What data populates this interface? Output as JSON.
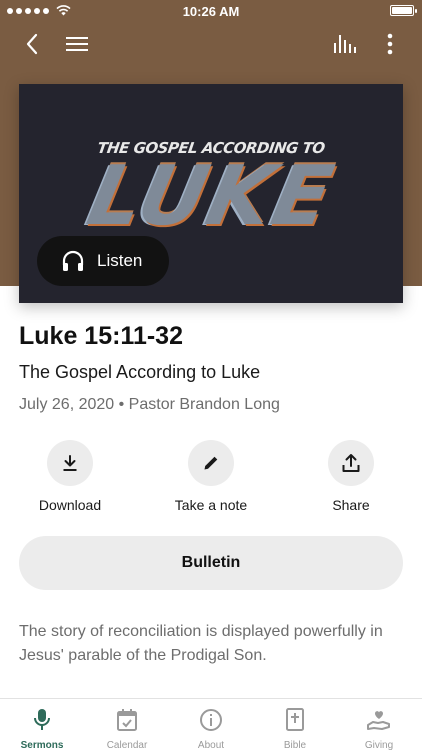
{
  "status_bar": {
    "time": "10:26 AM",
    "battery_level": 1.0
  },
  "hero": {
    "kicker": "THE GOSPEL ACCORDING TO",
    "title": "LUKE",
    "listen_label": "Listen"
  },
  "sermon": {
    "title": "Luke 15:11-32",
    "series": "The Gospel According to Luke",
    "meta": "July 26, 2020 • Pastor Brandon Long",
    "description": "The story of reconciliation is displayed powerfully in Jesus' parable of the Prodigal Son."
  },
  "actions": {
    "download": "Download",
    "note": "Take a note",
    "share": "Share"
  },
  "bulletin_label": "Bulletin",
  "tabs": {
    "sermons": "Sermons",
    "calendar": "Calendar",
    "about": "About",
    "bible": "Bible",
    "giving": "Giving"
  },
  "colors": {
    "header_brown": "#7a5c42",
    "active_tab": "#2e6b5a",
    "inactive_tab": "#9a9a9a"
  }
}
